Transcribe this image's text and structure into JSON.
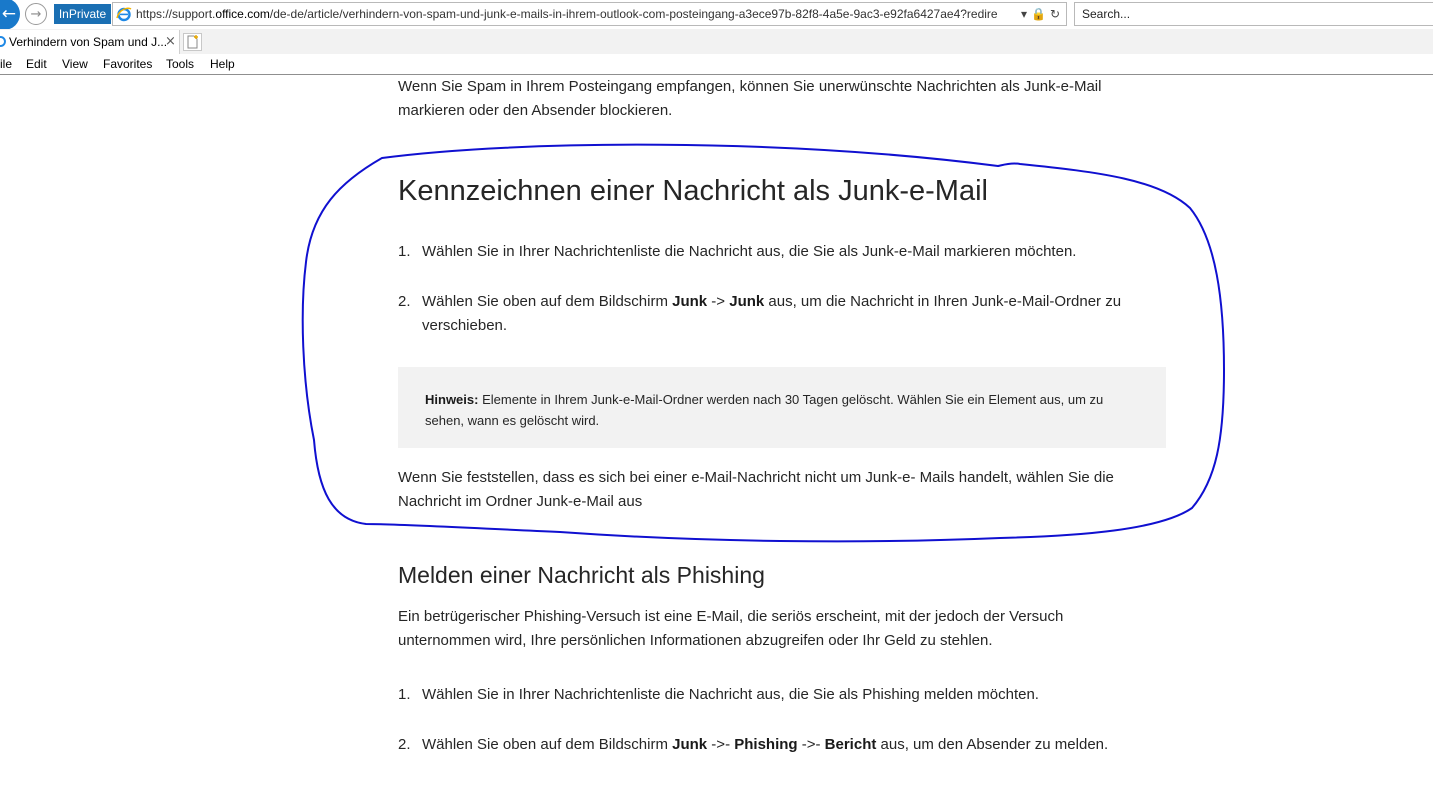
{
  "browser": {
    "mode_badge": "InPrivate",
    "url_prefix": "https://support.",
    "url_host": "office.com",
    "url_path": "/de-de/article/verhindern-von-spam-und-junk-e-mails-in-ihrem-outlook-com-posteingang-a3ece97b-82f8-4a5e-9ac3-e92fa6427ae4?redire",
    "search_placeholder": "Search...",
    "tab_title": "Verhindern von Spam und J...",
    "tab_close": "×",
    "menu": [
      "ile",
      "Edit",
      "View",
      "Favorites",
      "Tools",
      "Help"
    ]
  },
  "article": {
    "intro": "Wenn Sie Spam in Ihrem Posteingang empfangen, können Sie unerwünschte Nachrichten als Junk-e-Mail markieren oder den Absender blockieren.",
    "section1": {
      "heading": "Kennzeichnen einer Nachricht als Junk-e-Mail",
      "step1_num": "1.",
      "step1": "Wählen Sie in Ihrer Nachrichtenliste die Nachricht aus, die Sie als Junk-e-Mail markieren möchten.",
      "step2_num": "2.",
      "step2_pre": "Wählen Sie oben auf dem Bildschirm ",
      "step2_b1": "Junk",
      "step2_mid": " -> ",
      "step2_b2": "Junk",
      "step2_post": " aus, um die Nachricht in Ihren Junk-e-Mail-Ordner zu verschieben.",
      "note_label": "Hinweis:",
      "note_text": " Elemente in Ihrem Junk-e-Mail-Ordner werden nach 30 Tagen gelöscht. Wählen Sie ein Element aus, um zu sehen, wann es gelöscht wird.",
      "closing": "Wenn Sie feststellen, dass es sich bei einer e-Mail-Nachricht nicht um Junk-e- Mails handelt, wählen Sie die Nachricht im Ordner Junk-e-Mail aus"
    },
    "section2": {
      "heading": "Melden einer Nachricht als Phishing",
      "intro": "Ein betrügerischer Phishing-Versuch ist eine E-Mail, die seriös erscheint, mit der jedoch der Versuch unternommen wird, Ihre persönlichen Informationen abzugreifen oder Ihr Geld zu stehlen.",
      "step1_num": "1.",
      "step1": "Wählen Sie in Ihrer Nachrichtenliste die Nachricht aus, die Sie als Phishing melden möchten.",
      "step2_num": "2.",
      "step2_pre": "Wählen Sie oben auf dem Bildschirm ",
      "step2_b1": "Junk",
      "step2_sep1": " ->- ",
      "step2_b2": "Phishing",
      "step2_sep2": " ->- ",
      "step2_b3": "Bericht",
      "step2_post": " aus, um den Absender zu melden."
    }
  },
  "colors": {
    "annotation": "#1010d0",
    "inprivate": "#1a6fb3",
    "note_bg": "#f2f2f2"
  }
}
